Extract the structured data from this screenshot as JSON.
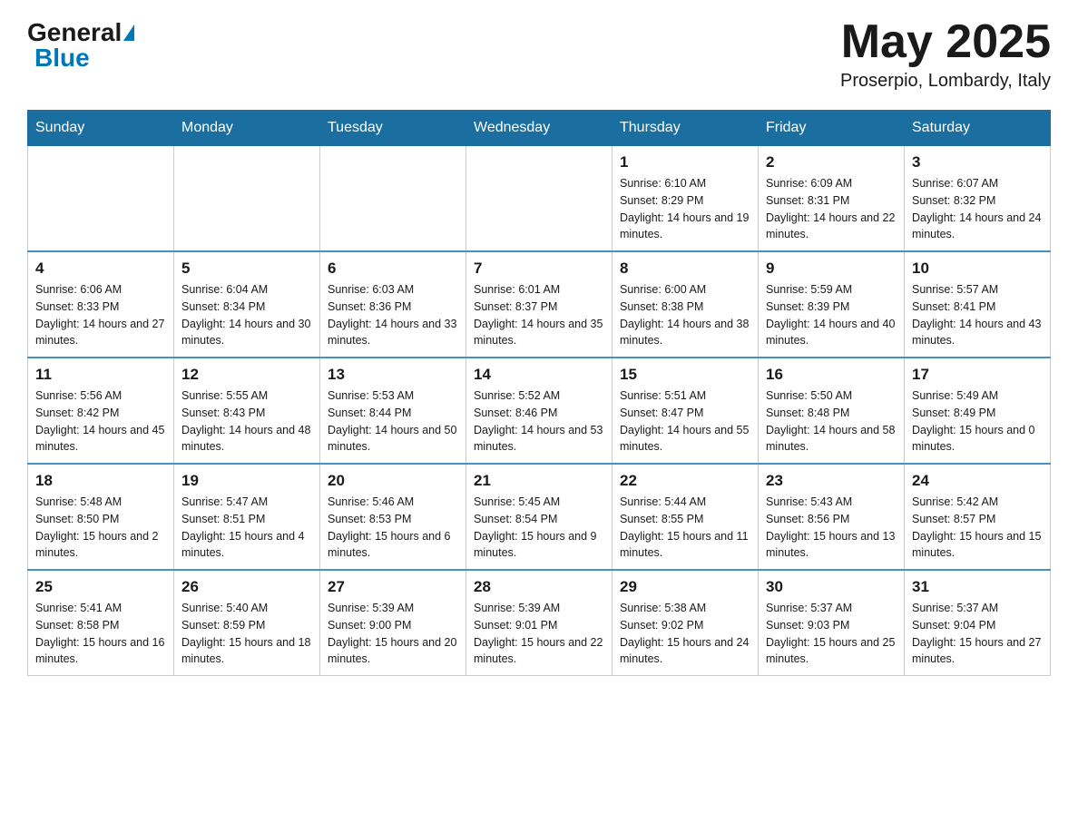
{
  "header": {
    "logo_general": "General",
    "logo_blue": "Blue",
    "month_title": "May 2025",
    "location": "Proserpio, Lombardy, Italy"
  },
  "days_of_week": [
    "Sunday",
    "Monday",
    "Tuesday",
    "Wednesday",
    "Thursday",
    "Friday",
    "Saturday"
  ],
  "weeks": [
    [
      {
        "day": "",
        "info": ""
      },
      {
        "day": "",
        "info": ""
      },
      {
        "day": "",
        "info": ""
      },
      {
        "day": "",
        "info": ""
      },
      {
        "day": "1",
        "info": "Sunrise: 6:10 AM\nSunset: 8:29 PM\nDaylight: 14 hours and 19 minutes."
      },
      {
        "day": "2",
        "info": "Sunrise: 6:09 AM\nSunset: 8:31 PM\nDaylight: 14 hours and 22 minutes."
      },
      {
        "day": "3",
        "info": "Sunrise: 6:07 AM\nSunset: 8:32 PM\nDaylight: 14 hours and 24 minutes."
      }
    ],
    [
      {
        "day": "4",
        "info": "Sunrise: 6:06 AM\nSunset: 8:33 PM\nDaylight: 14 hours and 27 minutes."
      },
      {
        "day": "5",
        "info": "Sunrise: 6:04 AM\nSunset: 8:34 PM\nDaylight: 14 hours and 30 minutes."
      },
      {
        "day": "6",
        "info": "Sunrise: 6:03 AM\nSunset: 8:36 PM\nDaylight: 14 hours and 33 minutes."
      },
      {
        "day": "7",
        "info": "Sunrise: 6:01 AM\nSunset: 8:37 PM\nDaylight: 14 hours and 35 minutes."
      },
      {
        "day": "8",
        "info": "Sunrise: 6:00 AM\nSunset: 8:38 PM\nDaylight: 14 hours and 38 minutes."
      },
      {
        "day": "9",
        "info": "Sunrise: 5:59 AM\nSunset: 8:39 PM\nDaylight: 14 hours and 40 minutes."
      },
      {
        "day": "10",
        "info": "Sunrise: 5:57 AM\nSunset: 8:41 PM\nDaylight: 14 hours and 43 minutes."
      }
    ],
    [
      {
        "day": "11",
        "info": "Sunrise: 5:56 AM\nSunset: 8:42 PM\nDaylight: 14 hours and 45 minutes."
      },
      {
        "day": "12",
        "info": "Sunrise: 5:55 AM\nSunset: 8:43 PM\nDaylight: 14 hours and 48 minutes."
      },
      {
        "day": "13",
        "info": "Sunrise: 5:53 AM\nSunset: 8:44 PM\nDaylight: 14 hours and 50 minutes."
      },
      {
        "day": "14",
        "info": "Sunrise: 5:52 AM\nSunset: 8:46 PM\nDaylight: 14 hours and 53 minutes."
      },
      {
        "day": "15",
        "info": "Sunrise: 5:51 AM\nSunset: 8:47 PM\nDaylight: 14 hours and 55 minutes."
      },
      {
        "day": "16",
        "info": "Sunrise: 5:50 AM\nSunset: 8:48 PM\nDaylight: 14 hours and 58 minutes."
      },
      {
        "day": "17",
        "info": "Sunrise: 5:49 AM\nSunset: 8:49 PM\nDaylight: 15 hours and 0 minutes."
      }
    ],
    [
      {
        "day": "18",
        "info": "Sunrise: 5:48 AM\nSunset: 8:50 PM\nDaylight: 15 hours and 2 minutes."
      },
      {
        "day": "19",
        "info": "Sunrise: 5:47 AM\nSunset: 8:51 PM\nDaylight: 15 hours and 4 minutes."
      },
      {
        "day": "20",
        "info": "Sunrise: 5:46 AM\nSunset: 8:53 PM\nDaylight: 15 hours and 6 minutes."
      },
      {
        "day": "21",
        "info": "Sunrise: 5:45 AM\nSunset: 8:54 PM\nDaylight: 15 hours and 9 minutes."
      },
      {
        "day": "22",
        "info": "Sunrise: 5:44 AM\nSunset: 8:55 PM\nDaylight: 15 hours and 11 minutes."
      },
      {
        "day": "23",
        "info": "Sunrise: 5:43 AM\nSunset: 8:56 PM\nDaylight: 15 hours and 13 minutes."
      },
      {
        "day": "24",
        "info": "Sunrise: 5:42 AM\nSunset: 8:57 PM\nDaylight: 15 hours and 15 minutes."
      }
    ],
    [
      {
        "day": "25",
        "info": "Sunrise: 5:41 AM\nSunset: 8:58 PM\nDaylight: 15 hours and 16 minutes."
      },
      {
        "day": "26",
        "info": "Sunrise: 5:40 AM\nSunset: 8:59 PM\nDaylight: 15 hours and 18 minutes."
      },
      {
        "day": "27",
        "info": "Sunrise: 5:39 AM\nSunset: 9:00 PM\nDaylight: 15 hours and 20 minutes."
      },
      {
        "day": "28",
        "info": "Sunrise: 5:39 AM\nSunset: 9:01 PM\nDaylight: 15 hours and 22 minutes."
      },
      {
        "day": "29",
        "info": "Sunrise: 5:38 AM\nSunset: 9:02 PM\nDaylight: 15 hours and 24 minutes."
      },
      {
        "day": "30",
        "info": "Sunrise: 5:37 AM\nSunset: 9:03 PM\nDaylight: 15 hours and 25 minutes."
      },
      {
        "day": "31",
        "info": "Sunrise: 5:37 AM\nSunset: 9:04 PM\nDaylight: 15 hours and 27 minutes."
      }
    ]
  ]
}
